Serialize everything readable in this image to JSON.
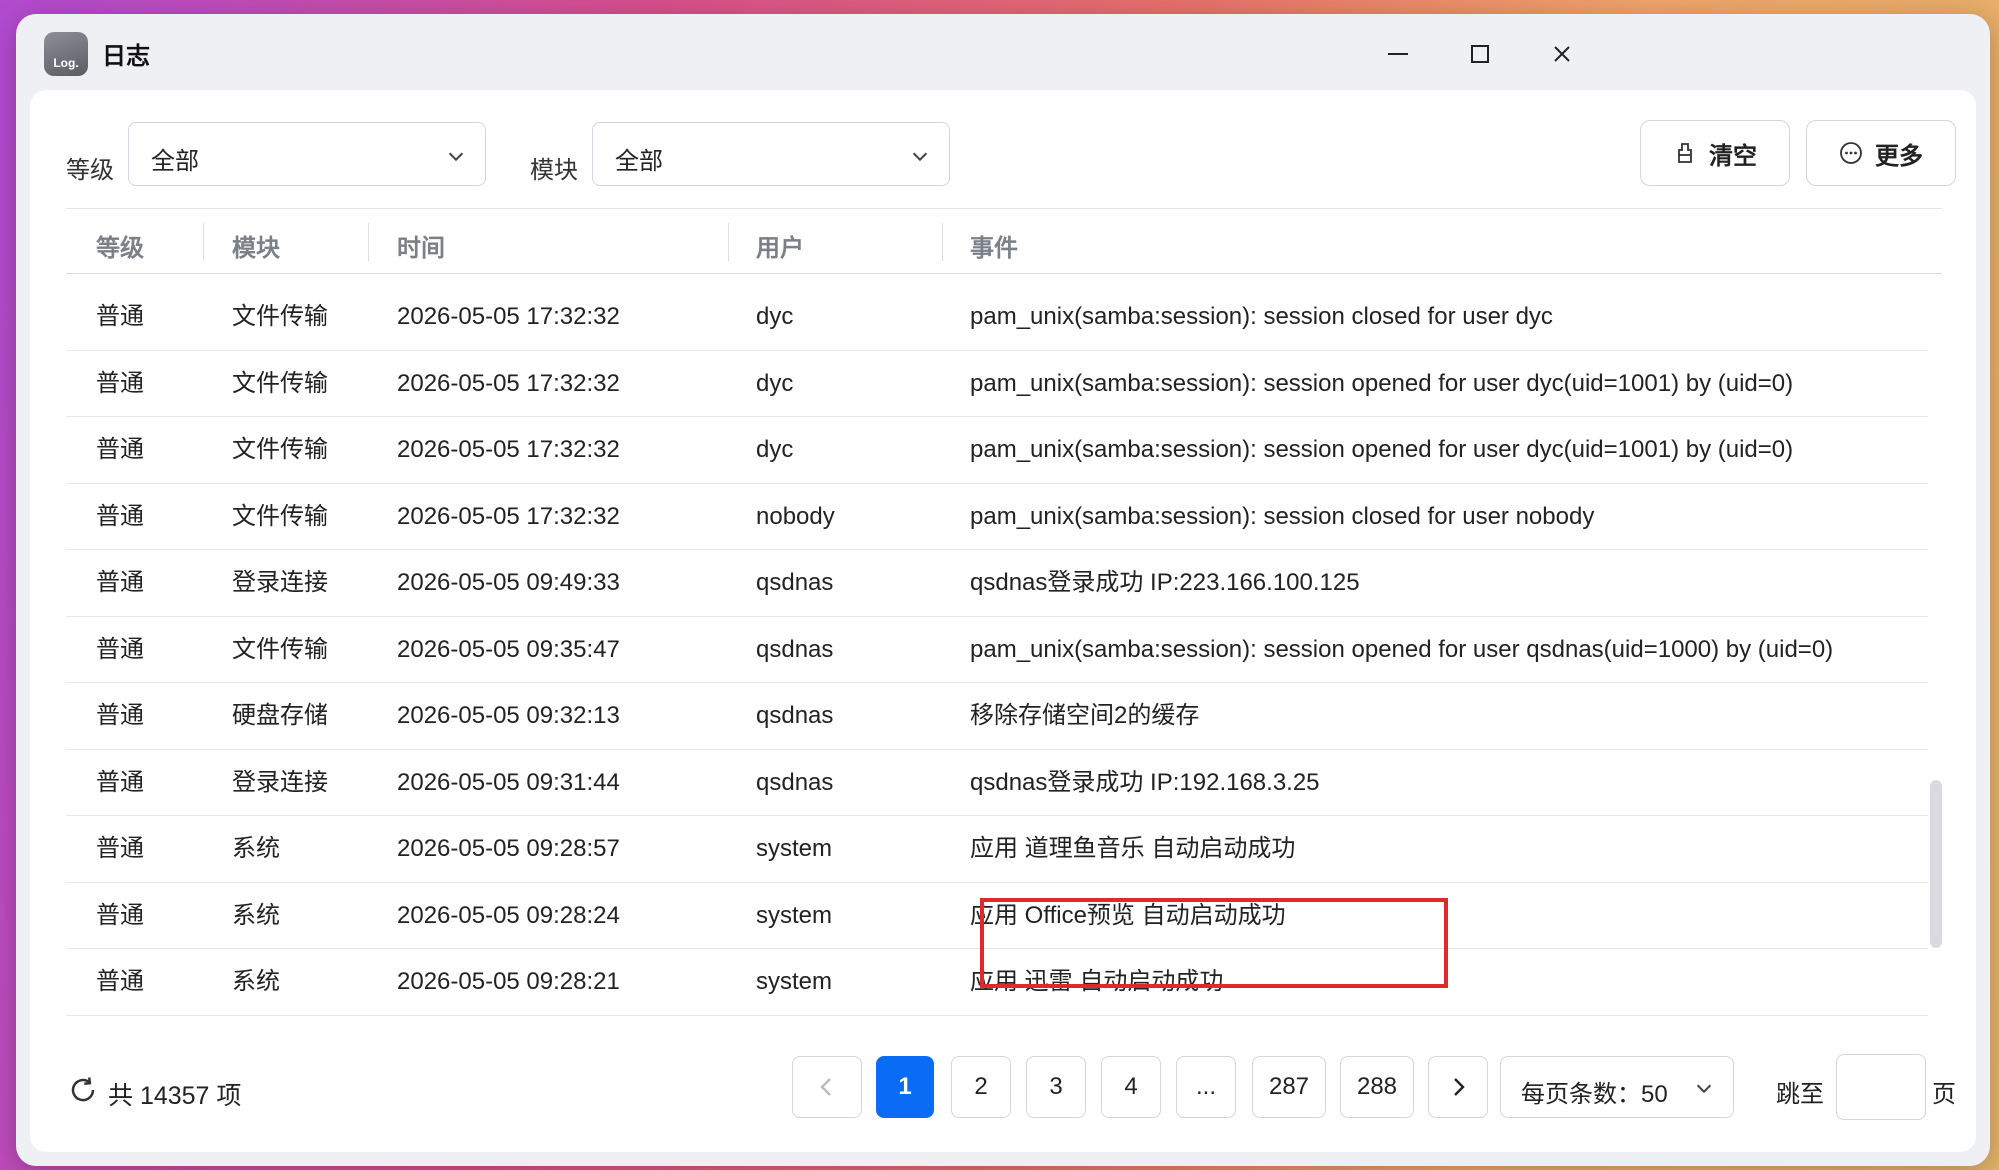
{
  "window": {
    "app_icon_text": "Log.",
    "title": "日志"
  },
  "filters": {
    "level_label": "等级",
    "level_value": "全部",
    "module_label": "模块",
    "module_value": "全部"
  },
  "actions": {
    "clear_label": "清空",
    "more_label": "更多"
  },
  "table": {
    "columns": [
      "等级",
      "模块",
      "时间",
      "用户",
      "事件"
    ],
    "rows": [
      {
        "level": "普通",
        "module": "文件传输",
        "time": "2026-05-05 17:32:32",
        "user": "dyc",
        "event": "pam_unix(samba:session): session closed for user dyc"
      },
      {
        "level": "普通",
        "module": "文件传输",
        "time": "2026-05-05 17:32:32",
        "user": "dyc",
        "event": "pam_unix(samba:session): session opened for user dyc(uid=1001) by (uid=0)"
      },
      {
        "level": "普通",
        "module": "文件传输",
        "time": "2026-05-05 17:32:32",
        "user": "dyc",
        "event": "pam_unix(samba:session): session opened for user dyc(uid=1001) by (uid=0)"
      },
      {
        "level": "普通",
        "module": "文件传输",
        "time": "2026-05-05 17:32:32",
        "user": "nobody",
        "event": "pam_unix(samba:session): session closed for user nobody"
      },
      {
        "level": "普通",
        "module": "登录连接",
        "time": "2026-05-05 09:49:33",
        "user": "qsdnas",
        "event": "qsdnas登录成功 IP:223.166.100.125"
      },
      {
        "level": "普通",
        "module": "文件传输",
        "time": "2026-05-05 09:35:47",
        "user": "qsdnas",
        "event": "pam_unix(samba:session): session opened for user qsdnas(uid=1000) by (uid=0)"
      },
      {
        "level": "普通",
        "module": "硬盘存储",
        "time": "2026-05-05 09:32:13",
        "user": "qsdnas",
        "event": "移除存储空间2的缓存"
      },
      {
        "level": "普通",
        "module": "登录连接",
        "time": "2026-05-05 09:31:44",
        "user": "qsdnas",
        "event": "qsdnas登录成功 IP:192.168.3.25"
      },
      {
        "level": "普通",
        "module": "系统",
        "time": "2026-05-05 09:28:57",
        "user": "system",
        "event": "应用 道理鱼音乐 自动启动成功"
      },
      {
        "level": "普通",
        "module": "系统",
        "time": "2026-05-05 09:28:24",
        "user": "system",
        "event": "应用 Office预览 自动启动成功"
      },
      {
        "level": "普通",
        "module": "系统",
        "time": "2026-05-05 09:28:21",
        "user": "system",
        "event": "应用 迅雷 自动启动成功"
      }
    ]
  },
  "footer": {
    "total_text": "共 14357 项",
    "pages": [
      "1",
      "2",
      "3",
      "4",
      "...",
      "287",
      "288"
    ],
    "current_page": "1",
    "per_page_text": "每页条数：50",
    "jump_label": "跳至",
    "jump_suffix": "页",
    "jump_value": ""
  },
  "colors": {
    "accent": "#0a6cf5",
    "highlight_box": "#e02a2a"
  },
  "icons": {
    "clear": "broom-icon",
    "more": "more-circle-icon",
    "refresh": "refresh-icon"
  }
}
